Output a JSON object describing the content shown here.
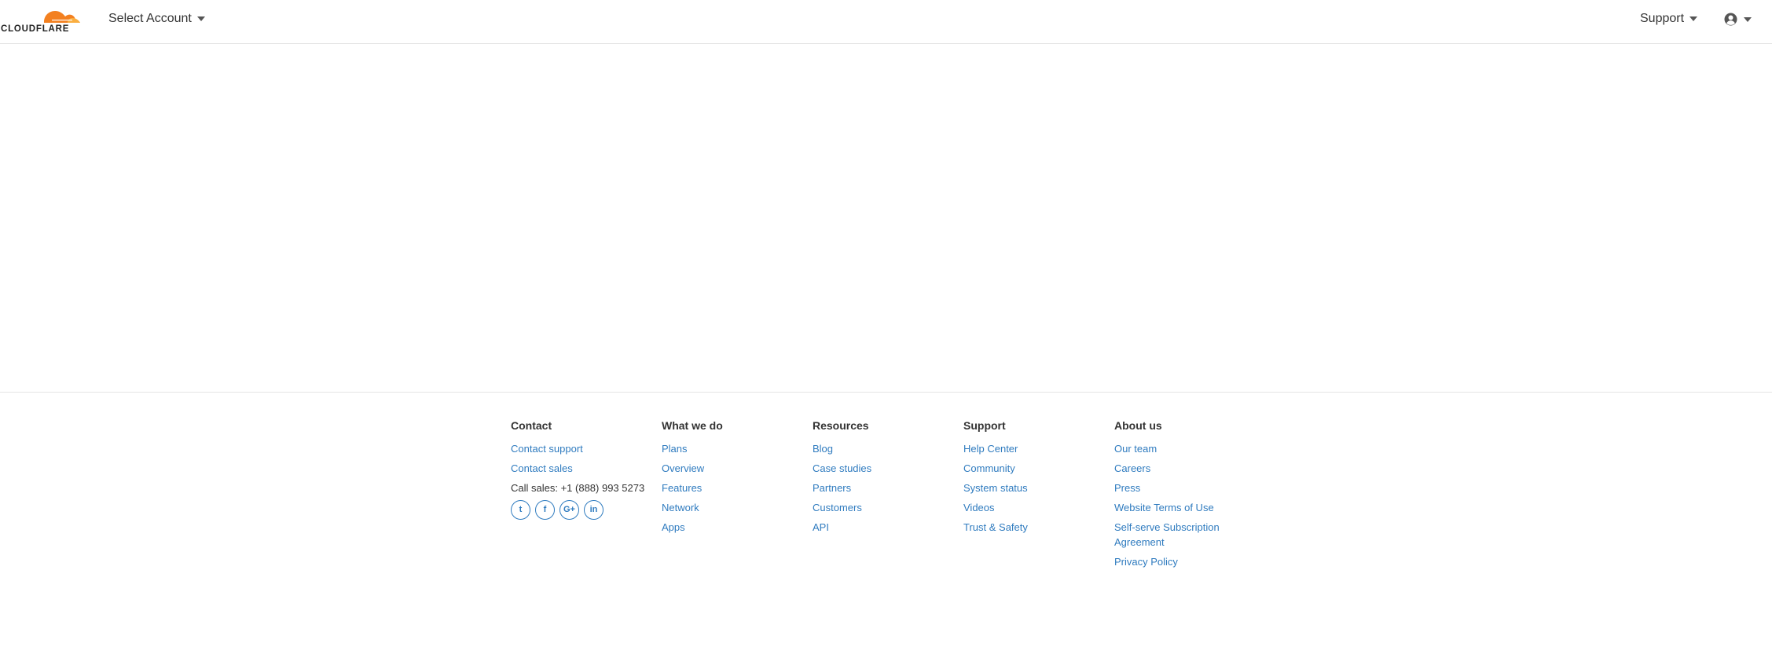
{
  "header": {
    "logo_text": "CLOUDFLARE",
    "account_select_label": "Select Account",
    "support_label": "Support"
  },
  "footer": {
    "columns": [
      {
        "title": "Contact",
        "items": [
          "Contact support",
          "Contact sales",
          "Call sales: +1 (888) 993 5273"
        ]
      },
      {
        "title": "What we do",
        "items": [
          "Plans",
          "Overview",
          "Features",
          "Network",
          "Apps"
        ]
      },
      {
        "title": "Resources",
        "items": [
          "Blog",
          "Case studies",
          "Partners",
          "Customers",
          "API"
        ]
      },
      {
        "title": "Support",
        "items": [
          "Help Center",
          "Community",
          "System status",
          "Videos",
          "Trust & Safety"
        ]
      },
      {
        "title": "About us",
        "items": [
          "Our team",
          "Careers",
          "Press",
          "Website Terms of Use",
          "Self-serve Subscription Agreement",
          "Privacy Policy"
        ]
      }
    ],
    "social": [
      {
        "icon": "twitter-icon",
        "glyph": "t"
      },
      {
        "icon": "facebook-icon",
        "glyph": "f"
      },
      {
        "icon": "google-plus-icon",
        "glyph": "G+"
      },
      {
        "icon": "linkedin-icon",
        "glyph": "in"
      }
    ]
  },
  "colors": {
    "brand_orange": "#f38020",
    "brand_orange_light": "#faae40",
    "link_blue": "#2f7bbf"
  }
}
